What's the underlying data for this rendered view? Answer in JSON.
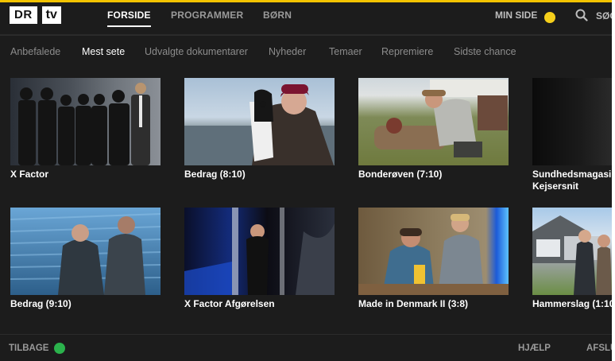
{
  "header": {
    "logo_dr": "DR",
    "logo_tv": "tv",
    "nav": [
      "FORSIDE",
      "PROGRAMMER",
      "BØRN"
    ],
    "min_side": "MIN SIDE",
    "search_label": "SØG"
  },
  "categories": [
    "Anbefalede",
    "Mest sete",
    "Udvalgte dokumentarer",
    "Nyheder",
    "Temaer",
    "Repremiere",
    "Sidste chance"
  ],
  "active_category": "Mest sete",
  "row1": [
    {
      "title": "X Factor",
      "subtitle": ""
    },
    {
      "title": "Bedrag (8:10)",
      "subtitle": ""
    },
    {
      "title": "Bonderøven (7:10)",
      "subtitle": ""
    },
    {
      "title": "Sundhedsmagasin",
      "subtitle": "Kejsersnit"
    }
  ],
  "row2": [
    {
      "title": "Bedrag (9:10)"
    },
    {
      "title": "X Factor Afgørelsen"
    },
    {
      "title": "Made in Denmark II (3:8)"
    },
    {
      "title": "Hammerslag (1:10"
    }
  ],
  "footer": {
    "back_label": "TILBAGE",
    "help_label": "HJÆLP",
    "exit_label": "AFSLU"
  },
  "colors": {
    "accent_yellow": "#f3c300",
    "dot_yellow": "#f5cf1b",
    "dot_green": "#2bb24c",
    "background": "#1c1c1c"
  }
}
